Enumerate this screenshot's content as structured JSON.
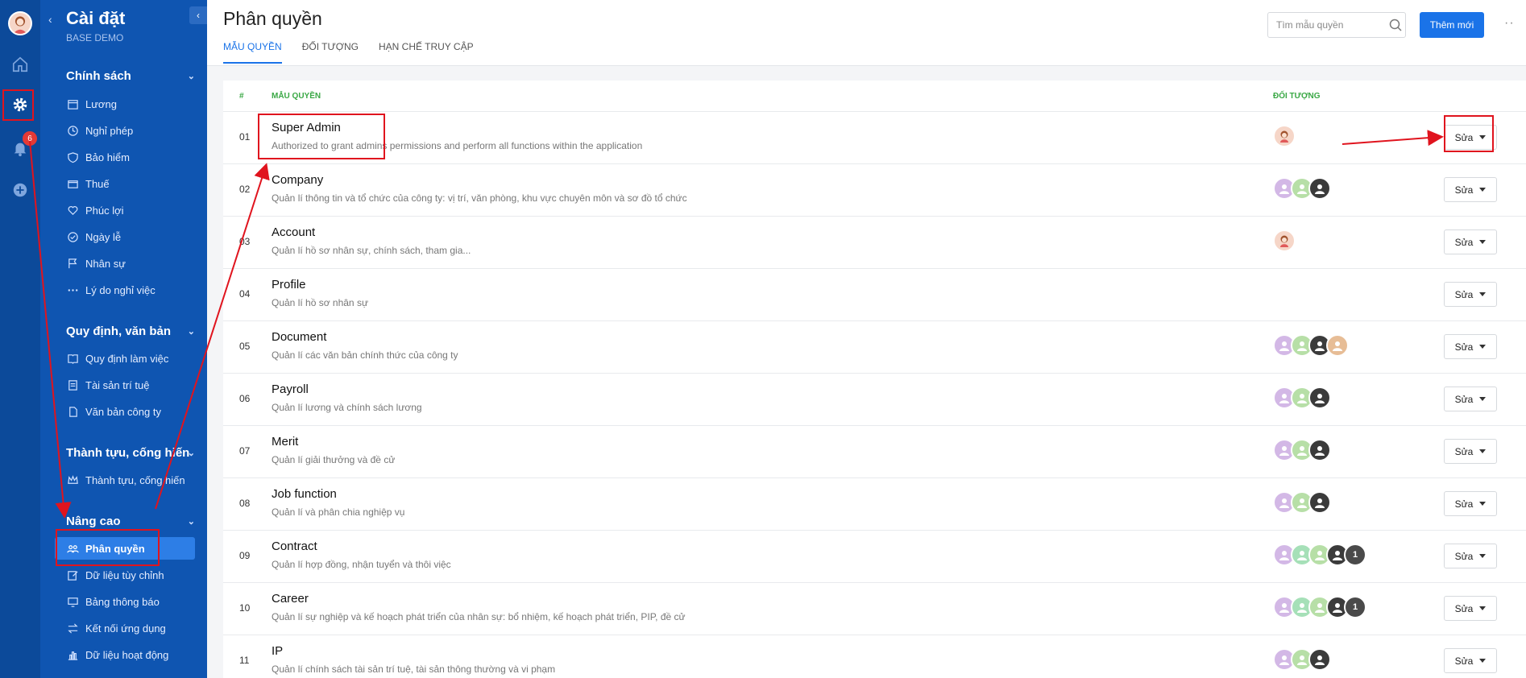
{
  "sidebar": {
    "title": "Cài đặt",
    "subtitle": "BASE DEMO",
    "badge": "6",
    "sections": [
      {
        "label": "Chính sách",
        "items": [
          "Lương",
          "Nghỉ phép",
          "Bảo hiểm",
          "Thuế",
          "Phúc lợi",
          "Ngày lễ",
          "Nhân sự",
          "Lý do nghỉ việc"
        ]
      },
      {
        "label": "Quy định, văn bản",
        "items": [
          "Quy định làm việc",
          "Tài sản trí tuệ",
          "Văn bản công ty"
        ]
      },
      {
        "label": "Thành tựu, cống hiến",
        "items": [
          "Thành tựu, cống hiến"
        ]
      },
      {
        "label": "Nâng cao",
        "items": [
          "Phân quyền",
          "Dữ liệu tùy chỉnh",
          "Bảng thông báo",
          "Kết nối ứng dụng",
          "Dữ liệu hoạt động"
        ]
      }
    ],
    "active_item": "Phân quyền"
  },
  "header": {
    "title": "Phân quyền",
    "tabs": [
      "MẪU QUYỀN",
      "ĐỐI TƯỢNG",
      "HẠN CHẾ TRUY CẬP"
    ],
    "search_placeholder": "Tìm mẫu quyền",
    "add_label": "Thêm mới",
    "more": "··"
  },
  "table": {
    "headers": {
      "num": "#",
      "name": "MẪU QUYỀN",
      "target": "ĐỐI TƯỢNG"
    },
    "edit_label": "Sửa",
    "rows": [
      {
        "num": "01",
        "name": "Super Admin",
        "desc": "Authorized to grant admins permissions and perform all functions within the application",
        "avatars": [
          "face"
        ]
      },
      {
        "num": "02",
        "name": "Company",
        "desc": "Quản lí thông tin và tổ chức của công ty: vị trí, văn phòng, khu vực chuyên môn và sơ đồ tổ chức",
        "avatars": [
          "c1",
          "c2",
          "photo"
        ]
      },
      {
        "num": "03",
        "name": "Account",
        "desc": "Quản lí hồ sơ nhân sự, chính sách, tham gia...",
        "avatars": [
          "face"
        ]
      },
      {
        "num": "04",
        "name": "Profile",
        "desc": "Quản lí hồ sơ nhân sự",
        "avatars": []
      },
      {
        "num": "05",
        "name": "Document",
        "desc": "Quản lí các văn bản chính thức của công ty",
        "avatars": [
          "c1",
          "c2",
          "photo",
          "tan"
        ]
      },
      {
        "num": "06",
        "name": "Payroll",
        "desc": "Quản lí lương và chính sách lương",
        "avatars": [
          "c1",
          "c2",
          "photo"
        ]
      },
      {
        "num": "07",
        "name": "Merit",
        "desc": "Quản lí giải thưởng và đề cử",
        "avatars": [
          "c1",
          "c2",
          "photo"
        ]
      },
      {
        "num": "08",
        "name": "Job function",
        "desc": "Quản lí và phân chia nghiệp vụ",
        "avatars": [
          "c1",
          "c2",
          "photo"
        ]
      },
      {
        "num": "09",
        "name": "Contract",
        "desc": "Quản lí hợp đồng, nhận tuyển và thôi việc",
        "avatars": [
          "c1",
          "c3",
          "c2",
          "photo",
          "dark"
        ],
        "extra": "1"
      },
      {
        "num": "10",
        "name": "Career",
        "desc": "Quản lí sự nghiệp và kế hoạch phát triển của nhân sự: bổ nhiệm, kế hoạch phát triển, PIP, đề cử",
        "avatars": [
          "c1",
          "c3",
          "c2",
          "photo",
          "dark"
        ],
        "extra": "1"
      },
      {
        "num": "11",
        "name": "IP",
        "desc": "Quản lí chính sách tài sản trí tuệ, tài sản thông thường và vi phạm",
        "avatars": [
          "c1",
          "c2",
          "photo"
        ]
      }
    ]
  },
  "colors": {
    "rail": "#0c4a9a",
    "sidebar": "#0f55b1",
    "accent": "#1a73e8",
    "header_green": "#3aa845",
    "annotation": "#e0141e"
  }
}
